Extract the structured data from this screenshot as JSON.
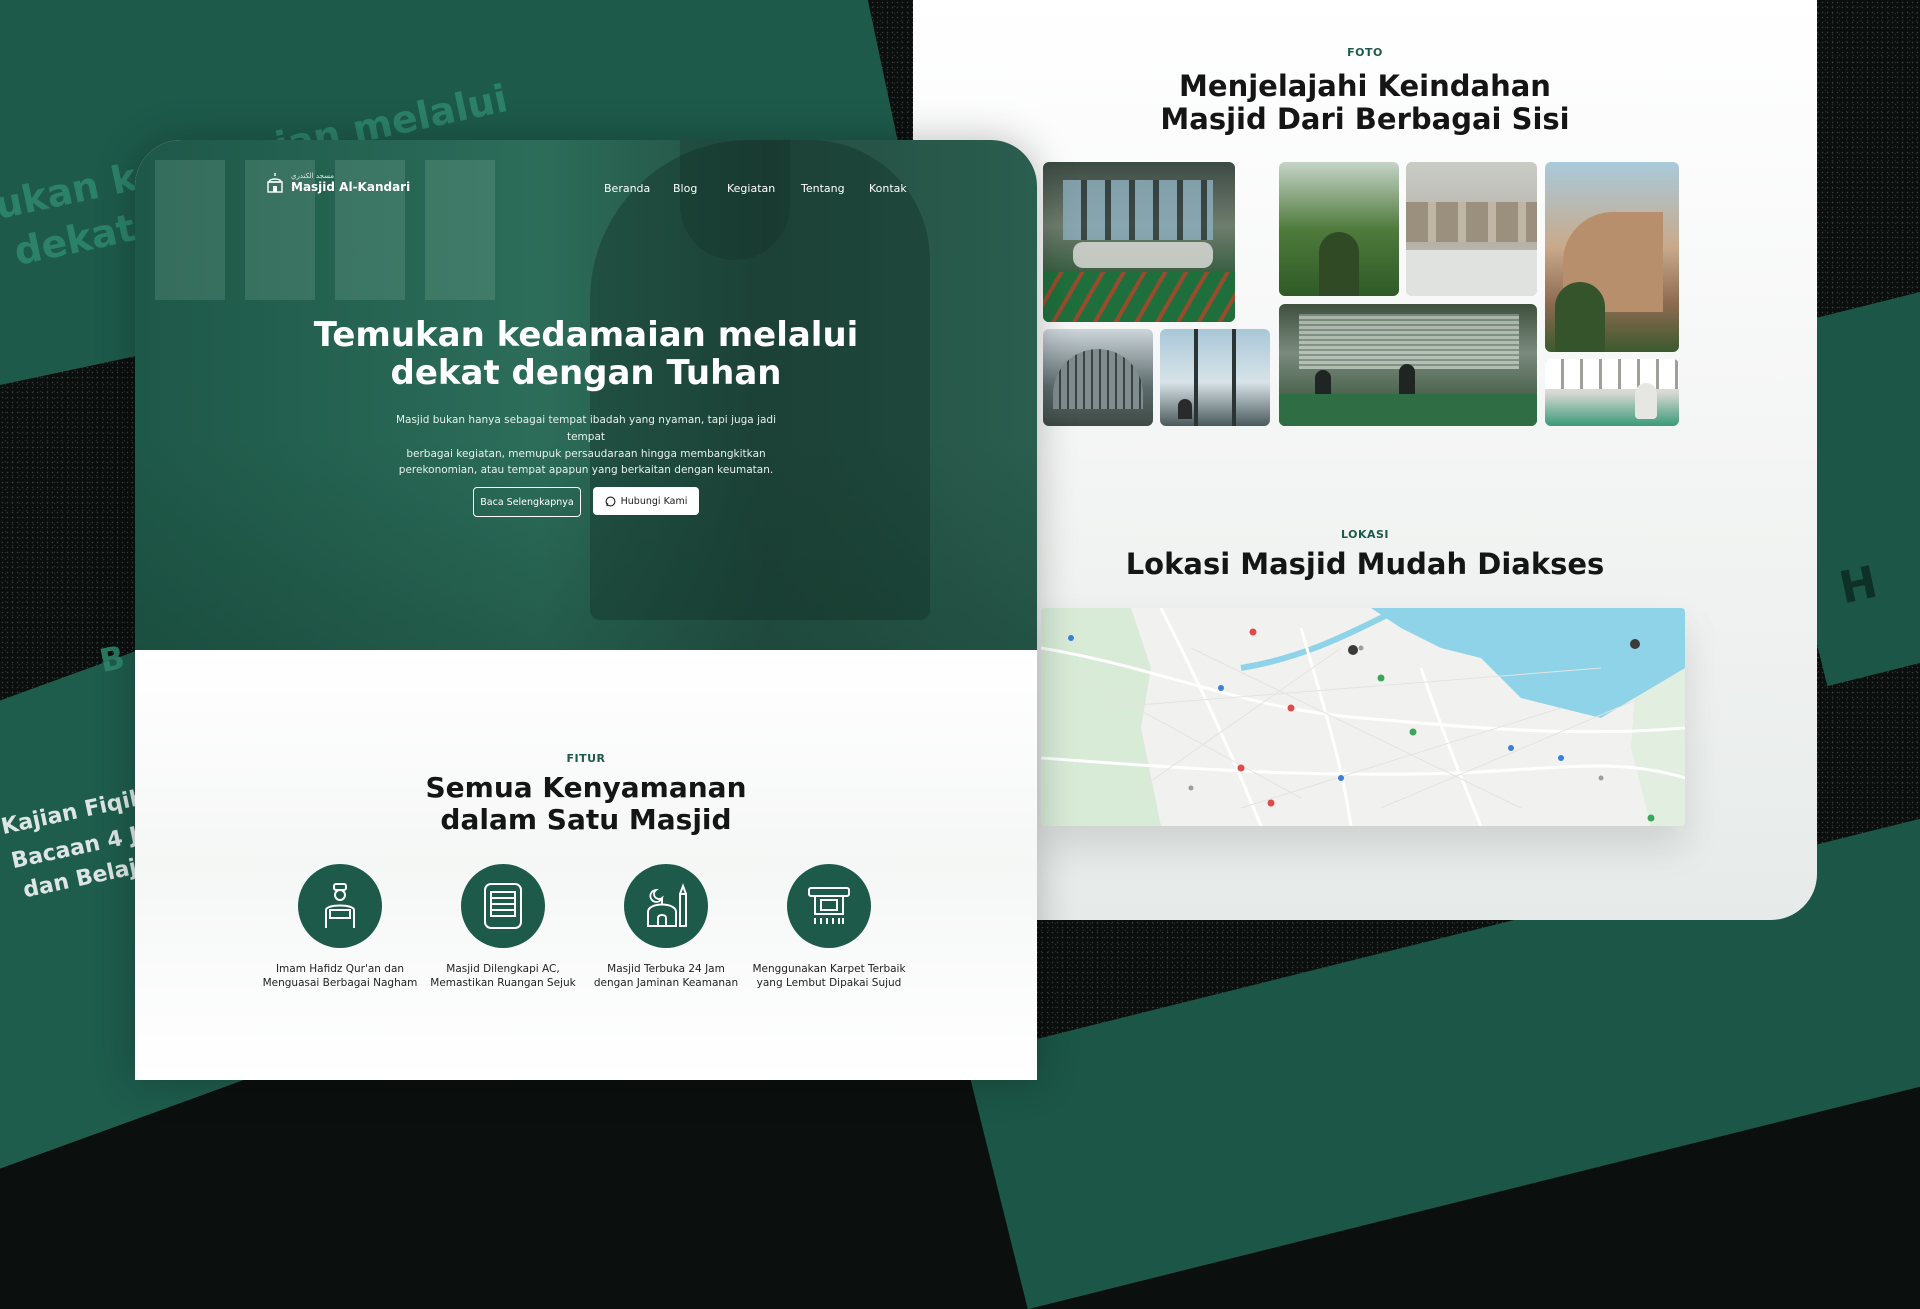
{
  "background": {
    "text_top": "ukan kedamaian melalui",
    "text_top_2": "dekat dengan Tuhan",
    "text_bottom_1": "Kajian Fiqih",
    "text_bottom_2": "Bacaan 4 Jilid",
    "text_bottom_3": "dan Belajar",
    "text_mid": "B",
    "text_right": "H"
  },
  "colors": {
    "primary": "#1d5a4a",
    "dark": "#151515",
    "white": "#ffffff"
  },
  "nav": {
    "logo_arabic": "مسجد الكندري",
    "logo_name": "Masjid Al-Kandari",
    "links": [
      "Beranda",
      "Blog",
      "Kegiatan",
      "Tentang",
      "Kontak"
    ]
  },
  "hero": {
    "title_line1": "Temukan kedamaian melalui",
    "title_line2": "dekat dengan Tuhan",
    "desc_line1": "Masjid bukan hanya sebagai tempat ibadah yang nyaman, tapi juga jadi tempat",
    "desc_line2": "berbagai kegiatan, memupuk persaudaraan hingga membangkitkan",
    "desc_line3": "perekonomian, atau tempat apapun yang berkaitan dengan keumatan.",
    "btn_read": "Baca Selengkapnya",
    "btn_contact": "Hubungi Kami",
    "btn_contact_icon": "whatsapp-icon"
  },
  "features": {
    "eyebrow": "FITUR",
    "title_line1": "Semua Kenyamanan",
    "title_line2": "dalam Satu Masjid",
    "items": [
      {
        "icon": "imam-icon",
        "line1": "Imam Hafidz Qur'an dan",
        "line2": "Menguasai Berbagai Nagham"
      },
      {
        "icon": "air-conditioner-icon",
        "line1": "Masjid Dilengkapi AC,",
        "line2": "Memastikan Ruangan Sejuk"
      },
      {
        "icon": "mosque-icon",
        "line1": "Masjid Terbuka 24 Jam",
        "line2": "dengan Jaminan Keamanan"
      },
      {
        "icon": "carpet-icon",
        "line1": "Menggunakan Karpet Terbaik",
        "line2": "yang Lembut Dipakai Sujud"
      }
    ]
  },
  "photos": {
    "eyebrow": "FOTO",
    "title_line1": "Menjelajahi Keindahan",
    "title_line2": "Masjid Dari Berbagai Sisi"
  },
  "location": {
    "eyebrow": "LOKASI",
    "title": "Lokasi Masjid Mudah Diakses"
  }
}
